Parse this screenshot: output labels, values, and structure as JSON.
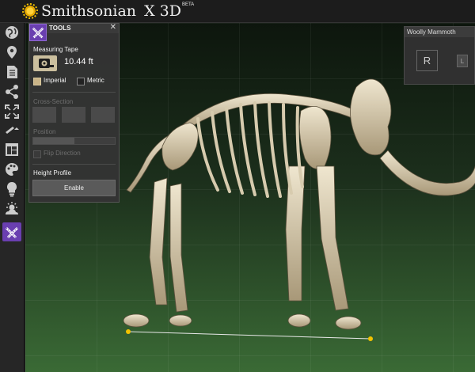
{
  "header": {
    "brand": "Smithsonian",
    "product": "X 3D",
    "badge": "BETA"
  },
  "sidebar": {
    "items": [
      {
        "name": "globe-icon"
      },
      {
        "name": "pin-icon"
      },
      {
        "name": "document-icon"
      },
      {
        "name": "share-icon"
      },
      {
        "name": "fullscreen-icon"
      },
      {
        "name": "pen-icon"
      },
      {
        "name": "layout-icon"
      },
      {
        "name": "palette-icon"
      },
      {
        "name": "lightbulb-icon"
      },
      {
        "name": "weather-icon"
      },
      {
        "name": "tools-icon"
      }
    ]
  },
  "tools": {
    "title": "TOOLS",
    "close": "✕",
    "measuring_tape": {
      "label": "Measuring Tape",
      "value": "10.44 ft",
      "imperial": "Imperial",
      "metric": "Metric",
      "units_selected": "Imperial"
    },
    "cross_section": {
      "label": "Cross-Section"
    },
    "position": {
      "label": "Position",
      "level": 0.5
    },
    "flip": {
      "label": "Flip Direction"
    },
    "height_profile": {
      "label": "Height Profile",
      "button": "Enable"
    }
  },
  "model_panel": {
    "title": "Woolly Mammoth",
    "r_button": "R",
    "l_button": "L"
  },
  "colors": {
    "accent": "#6a3fb0",
    "bone": "#d8ccb0",
    "marker": "#f2c200"
  }
}
